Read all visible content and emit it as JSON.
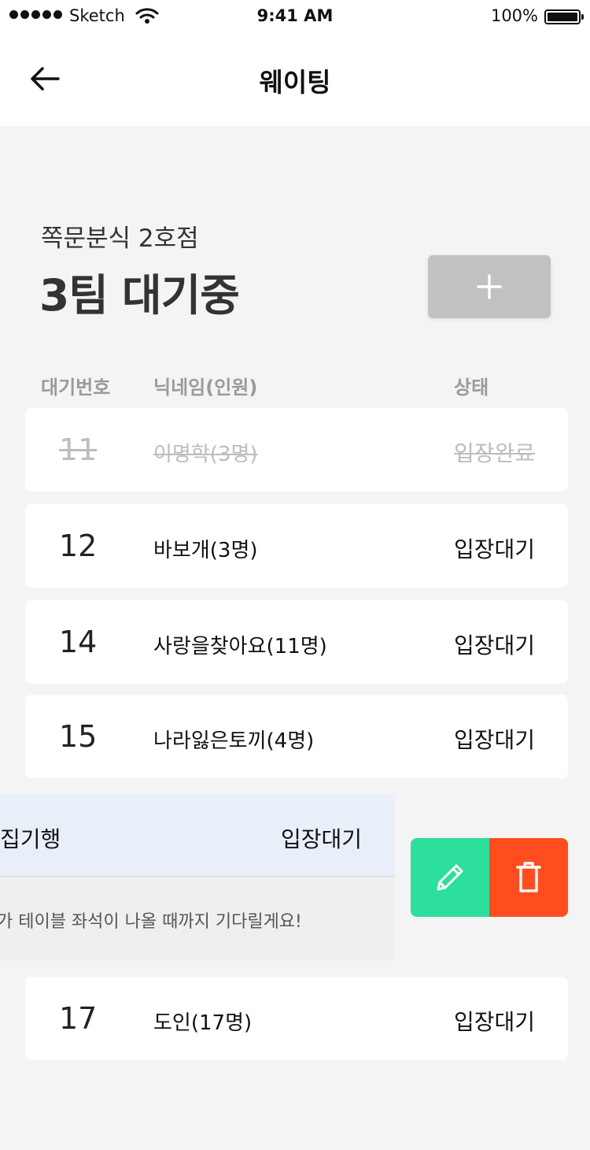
{
  "status_bar": {
    "carrier": "Sketch",
    "time": "9:41 AM",
    "battery": "100%"
  },
  "nav": {
    "title": "웨이팅",
    "back_icon": "arrow-left-icon"
  },
  "header": {
    "store_name": "쪽문분식 2호점",
    "wait_count": "3팀 대기중",
    "add_icon": "plus-icon"
  },
  "columns": {
    "number": "대기번호",
    "name": "닉네임(인원)",
    "status": "상태"
  },
  "rows": [
    {
      "number": "11",
      "name": "이명학(3명)",
      "status": "입장완료",
      "done": true
    },
    {
      "number": "12",
      "name": "바보개(3명)",
      "status": "입장대기"
    },
    {
      "number": "14",
      "name": "사랑을찾아요(11명)",
      "status": "입장대기"
    },
    {
      "number": "15",
      "name": "나라잃은토끼(4명)",
      "status": "입장대기"
    }
  ],
  "swiped_row": {
    "name": "집기행",
    "status": "입장대기",
    "memo": "가 테이블 좌석이 나올 때까지 기다릴게요!"
  },
  "actions": {
    "edit_icon": "pencil-icon",
    "delete_icon": "trash-icon"
  },
  "last_row": {
    "number": "17",
    "name": "도인(17명)",
    "status": "입장대기"
  },
  "colors": {
    "background": "#f4f4f4",
    "add_button": "#c1c1c1",
    "edit": "#2ddf9c",
    "delete": "#ff4d1f",
    "swiped_highlight": "#e9eff8",
    "done_text": "#bdbdbd"
  }
}
